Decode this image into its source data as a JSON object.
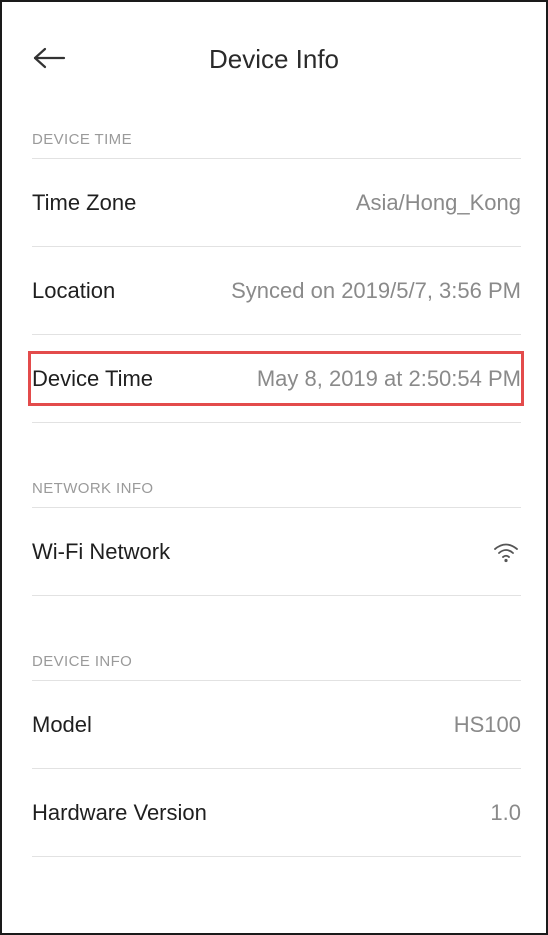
{
  "header": {
    "title": "Device Info",
    "back_icon": "arrow-left-icon"
  },
  "sections": {
    "device_time": {
      "heading": "DEVICE TIME",
      "time_zone": {
        "label": "Time Zone",
        "value": "Asia/Hong_Kong"
      },
      "location": {
        "label": "Location",
        "value": "Synced on 2019/5/7, 3:56 PM"
      },
      "device_time": {
        "label": "Device Time",
        "value": "May 8, 2019 at 2:50:54 PM"
      }
    },
    "network_info": {
      "heading": "NETWORK INFO",
      "wifi": {
        "label": "Wi-Fi Network",
        "icon": "wifi-icon"
      }
    },
    "device_info": {
      "heading": "DEVICE INFO",
      "model": {
        "label": "Model",
        "value": "HS100"
      },
      "hardware": {
        "label": "Hardware Version",
        "value": "1.0"
      }
    }
  },
  "colors": {
    "highlight": "#e34b4b",
    "divider": "#e2e2e2",
    "muted_text": "#8a8a8a"
  }
}
